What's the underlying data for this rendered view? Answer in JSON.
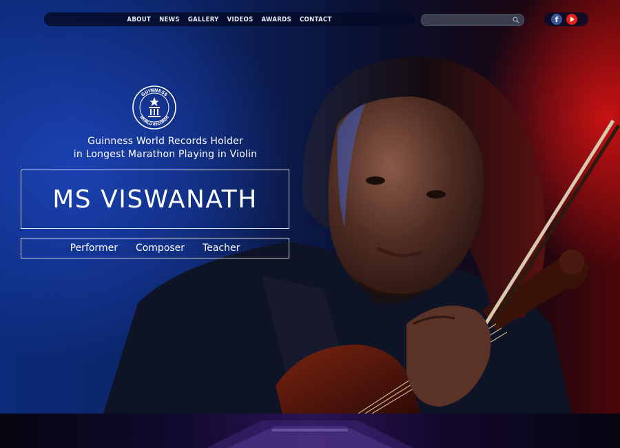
{
  "nav": {
    "items": [
      {
        "label": "ABOUT"
      },
      {
        "label": "NEWS"
      },
      {
        "label": "GALLERY"
      },
      {
        "label": "VIDEOS"
      },
      {
        "label": "AWARDS"
      },
      {
        "label": "CONTACT"
      }
    ]
  },
  "search": {
    "placeholder": ""
  },
  "social": {
    "facebook_icon": "facebook-icon",
    "facebook_glyph": "f",
    "youtube_icon": "youtube-icon"
  },
  "badge": {
    "text_top": "GUINNESS",
    "text_bottom": "WORLD RECORDS"
  },
  "hero": {
    "tagline_line1": "Guinness World Records Holder",
    "tagline_line2": "in Longest Marathon Playing in Violin",
    "name": "MS VISWANATH",
    "roles": [
      "Performer",
      "Composer",
      "Teacher"
    ]
  },
  "colors": {
    "facebook": "#3b5998",
    "youtube": "#e62117",
    "accent_blue": "#0b2a78",
    "accent_red": "#c41212"
  }
}
